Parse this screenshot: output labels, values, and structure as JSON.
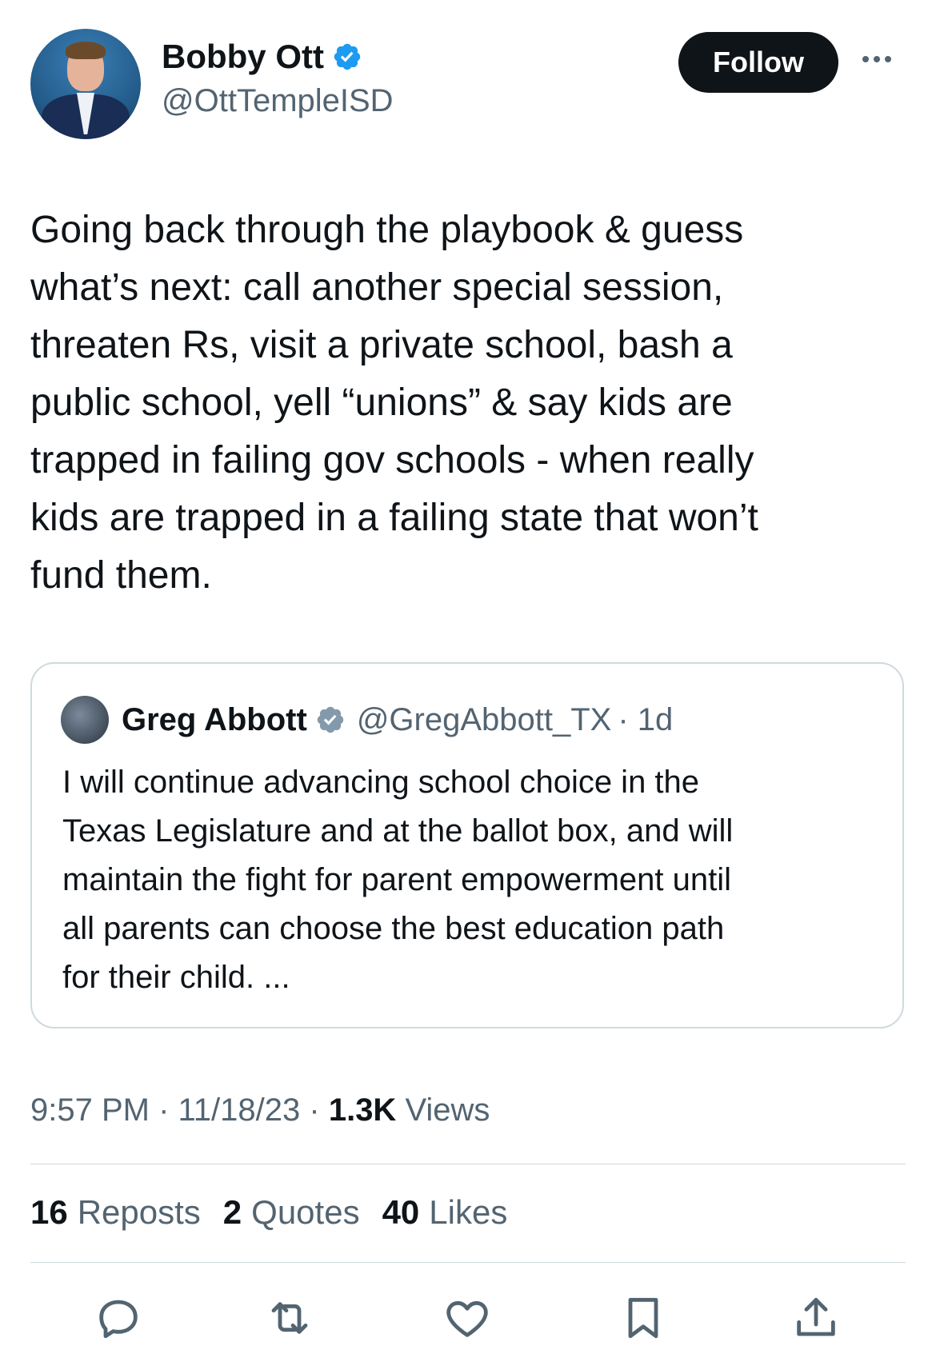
{
  "author": {
    "name": "Bobby Ott",
    "handle": "@OttTempleISD",
    "verified_color": "#1d9bf0"
  },
  "follow_label": "Follow",
  "tweet_text": "Going back through the playbook & guess\nwhat’s next: call another special session,\nthreaten Rs, visit a private school, bash a\npublic school, yell “unions” & say kids are\ntrapped in failing gov schools - when really\nkids are trapped in a failing state that won’t\nfund them.",
  "quote": {
    "name": "Greg Abbott",
    "handle": "@GregAbbott_TX",
    "time": "· 1d",
    "text": "I will continue advancing school choice in the\nTexas Legislature and at the ballot box, and will\nmaintain the fight for parent empowerment until\nall parents can choose the best education path\nfor their child. ...",
    "verified_color": "#829aab"
  },
  "meta": {
    "time": "9:57 PM",
    "date": "11/18/23",
    "views_count": "1.3K",
    "views_label": "Views"
  },
  "stats": {
    "reposts_count": "16",
    "reposts_label": "Reposts",
    "quotes_count": "2",
    "quotes_label": "Quotes",
    "likes_count": "40",
    "likes_label": "Likes"
  },
  "icons": [
    "reply-icon",
    "repost-icon",
    "like-icon",
    "bookmark-icon",
    "share-icon",
    "more-icon",
    "verified-badge-icon"
  ]
}
